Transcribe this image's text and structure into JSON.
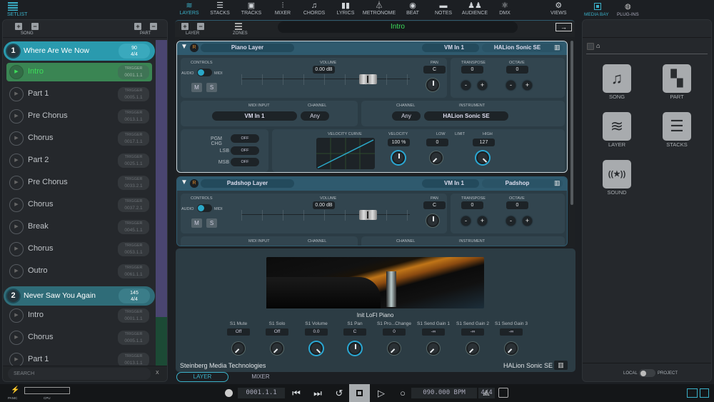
{
  "left": {
    "setlist_label": "SETLIST",
    "song_label": "SONG",
    "part_label": "PART",
    "search_placeholder": "SEARCH",
    "search_clear": "X",
    "trigger_label": "TRIGGER",
    "entries": [
      {
        "type": "song",
        "num": "1",
        "name": "Where Are We Now",
        "tempo": "90",
        "sig": "4/4",
        "selected": true
      },
      {
        "type": "part",
        "name": "Intro",
        "pos": "0001.1.1",
        "active": true
      },
      {
        "type": "part",
        "name": "Part 1",
        "pos": "0005.1.1"
      },
      {
        "type": "part",
        "name": "Pre Chorus",
        "pos": "0013.1.1"
      },
      {
        "type": "part",
        "name": "Chorus",
        "pos": "0017.1.1"
      },
      {
        "type": "part",
        "name": "Part 2",
        "pos": "0025.1.1"
      },
      {
        "type": "part",
        "name": "Pre Chorus",
        "pos": "0033.2.1"
      },
      {
        "type": "part",
        "name": "Chorus",
        "pos": "0037.2.1"
      },
      {
        "type": "part",
        "name": "Break",
        "pos": "0045.1.1"
      },
      {
        "type": "part",
        "name": "Chorus",
        "pos": "0053.1.1"
      },
      {
        "type": "part",
        "name": "Outro",
        "pos": "0061.1.1"
      },
      {
        "type": "song",
        "num": "2",
        "name": "Never Saw You Again",
        "tempo": "145",
        "sig": "4/4"
      },
      {
        "type": "part",
        "name": "Intro",
        "pos": "0001.1.1"
      },
      {
        "type": "part",
        "name": "Chorus",
        "pos": "0005.1.1"
      },
      {
        "type": "part",
        "name": "Part 1",
        "pos": "0013.1.1"
      }
    ]
  },
  "nav": {
    "tabs": [
      {
        "label": "LAYERS",
        "icon": "layers-icon",
        "active": true
      },
      {
        "label": "STACKS",
        "icon": "stacks-icon"
      },
      {
        "label": "TRACKS",
        "icon": "tracks-icon"
      },
      {
        "label": "MIXER",
        "icon": "mixer-icon"
      },
      {
        "label": "CHORDS",
        "icon": "music-note-icon"
      },
      {
        "label": "LYRICS",
        "icon": "book-icon"
      },
      {
        "label": "METRONOME",
        "icon": "metronome-icon"
      },
      {
        "label": "BEAT",
        "icon": "beat-icon"
      },
      {
        "label": "NOTES",
        "icon": "notes-icon"
      },
      {
        "label": "AUDIENCE",
        "icon": "audience-icon"
      },
      {
        "label": "DMX",
        "icon": "dmx-icon"
      }
    ],
    "views_label": "VIEWS"
  },
  "toolbar": {
    "layer_label": "LAYER",
    "zones_label": "ZONES",
    "current_part": "Intro"
  },
  "layers": [
    {
      "name": "Piano Layer",
      "midi_in": "VM In 1",
      "instrument": "HALion Sonic SE",
      "volume": "0.00 dB",
      "pan": "C",
      "transpose": "0",
      "octave": "0",
      "channel_in": "Any",
      "channel_out": "Any",
      "velocity": "100 %",
      "low": "0",
      "high": "127",
      "pgm_chg": "OFF",
      "lsb": "OFF",
      "msb": "OFF"
    },
    {
      "name": "Padshop Layer",
      "midi_in": "VM In 1",
      "instrument": "Padshop",
      "volume": "0.00 dB",
      "pan": "C",
      "transpose": "0",
      "octave": "0"
    }
  ],
  "layer_labels": {
    "controls": "CONTROLS",
    "audio": "AUDIO",
    "midi": "MIDI",
    "mute": "M",
    "solo": "S",
    "volume": "VOLUME",
    "pan": "PAN",
    "transpose": "TRANSPOSE",
    "octave": "OCTAVE",
    "minus": "-",
    "plus": "+",
    "midi_input": "MIDI INPUT",
    "channel": "CHANNEL",
    "instrument": "INSTRUMENT",
    "pgm_chg": "PGM CHG",
    "lsb": "LSB",
    "msb": "MSB",
    "velocity_curve": "VELOCITY CURVE",
    "velocity": "VELOCITY",
    "low": "LOW",
    "limit": "LIMIT",
    "high": "HIGH",
    "record": "R"
  },
  "plugin": {
    "preset": "Init LoFI Piano",
    "vendor": "Steinberg Media Technologies",
    "name": "HALion Sonic SE",
    "params": [
      {
        "label": "S1 Mute",
        "value": "Off"
      },
      {
        "label": "S1 Solo",
        "value": "Off"
      },
      {
        "label": "S1 Volume",
        "value": "0.0"
      },
      {
        "label": "S1 Pan",
        "value": "C"
      },
      {
        "label": "S1 Pro...Change",
        "value": "0"
      },
      {
        "label": "S1 Send Gain 1",
        "value": "-∞"
      },
      {
        "label": "S1 Send Gain 2",
        "value": "-∞"
      },
      {
        "label": "S1 Send Gain 3",
        "value": "-∞"
      }
    ],
    "tabs": [
      {
        "label": "LAYER",
        "active": true
      },
      {
        "label": "MIXER"
      }
    ]
  },
  "right": {
    "tabs": [
      {
        "label": "MEDIA BAY",
        "active": true
      },
      {
        "label": "PLUG-INS"
      }
    ],
    "items": [
      {
        "label": "SONG",
        "icon": "music-note-icon"
      },
      {
        "label": "PART",
        "icon": "part-grid-icon"
      },
      {
        "label": "LAYER",
        "icon": "layers-icon"
      },
      {
        "label": "STACKS",
        "icon": "stacks-icon"
      },
      {
        "label": "SOUND",
        "icon": "sound-icon"
      }
    ],
    "local_label": "LOCAL",
    "project_label": "PROJECT"
  },
  "transport": {
    "position": "0001.1.1",
    "tempo": "090.000 BPM",
    "signature": "4/4",
    "panic_label": "PANIC",
    "cpu_label": "CPU"
  },
  "colors": {
    "accent": "#3ab0c8",
    "active_part": "#3a8553",
    "song_selected": "#2a9aae",
    "song": "#2f6c78"
  }
}
